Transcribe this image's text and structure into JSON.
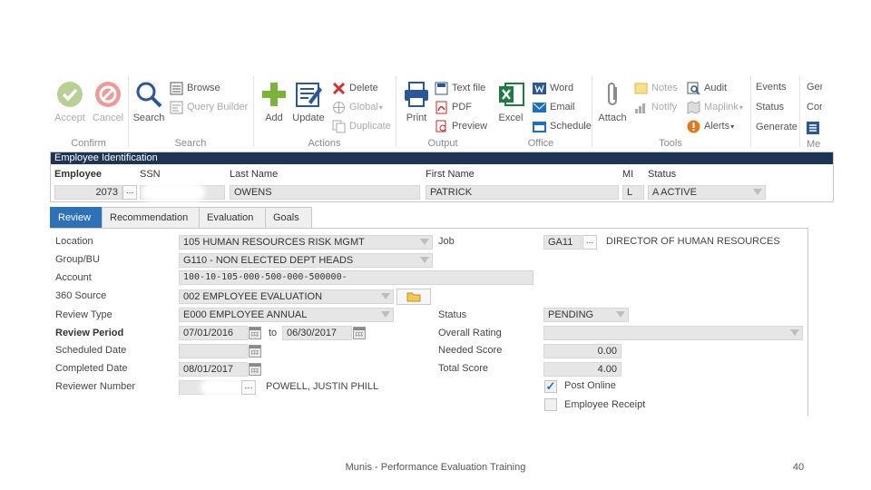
{
  "ribbon": {
    "confirm": {
      "group_label": "Confirm",
      "accept": "Accept",
      "cancel": "Cancel"
    },
    "search": {
      "group_label": "Search",
      "search": "Search",
      "browse": "Browse",
      "query_builder": "Query Builder"
    },
    "actions": {
      "group_label": "Actions",
      "add": "Add",
      "update": "Update",
      "delete": "Delete",
      "global": "Global",
      "duplicate": "Duplicate"
    },
    "output": {
      "group_label": "Output",
      "print": "Print",
      "text_file": "Text file",
      "pdf": "PDF",
      "preview": "Preview"
    },
    "office": {
      "group_label": "Office",
      "excel": "Excel",
      "word": "Word",
      "email": "Email",
      "schedule": "Schedule"
    },
    "tools": {
      "group_label": "Tools",
      "attach": "Attach",
      "notes": "Notes",
      "notify": "Notify",
      "audit": "Audit",
      "maplink": "Maplink",
      "alerts": "Alerts"
    },
    "extra": {
      "events": "Events",
      "status": "Status",
      "generate": "Generate",
      "gen_cut": "Ger",
      "con_cut": "Cor",
      "menu_cut": "Me"
    }
  },
  "employee_id": {
    "title": "Employee Identification",
    "headers": {
      "employee": "Employee",
      "ssn": "SSN",
      "last_name": "Last Name",
      "first_name": "First Name",
      "mi": "MI",
      "status": "Status"
    },
    "values": {
      "employee": "2073",
      "ellipsis": "...",
      "last_name": "OWENS",
      "first_name": "PATRICK",
      "mi": "L",
      "status": "A   ACTIVE"
    }
  },
  "tabs": [
    "Review",
    "Recommendation",
    "Evaluation",
    "Goals"
  ],
  "review": {
    "location": {
      "label": "Location",
      "value": "105   HUMAN RESOURCES RISK MGMT"
    },
    "group_bu": {
      "label": "Group/BU",
      "value": "G110 - NON ELECTED DEPT HEADS"
    },
    "account": {
      "label": "Account",
      "value": "100-10-105-000-500-000-500000-"
    },
    "source_360": {
      "label": "360 Source",
      "value": "002   EMPLOYEE EVALUATION"
    },
    "review_type": {
      "label": "Review Type",
      "value": "E000   EMPLOYEE ANNUAL"
    },
    "review_period": {
      "label": "Review Period",
      "from": "07/01/2016",
      "to_label": "to",
      "to": "06/30/2017"
    },
    "scheduled_date": {
      "label": "Scheduled Date",
      "value": ""
    },
    "completed_date": {
      "label": "Completed Date",
      "value": "08/01/2017"
    },
    "reviewer_number": {
      "label": "Reviewer Number",
      "name": "POWELL, JUSTIN PHILL"
    },
    "job": {
      "label": "Job",
      "code": "GA11",
      "ellipsis": "...",
      "title": "DIRECTOR OF HUMAN RESOURCES"
    },
    "status": {
      "label": "Status",
      "value": "PENDING"
    },
    "overall_rating": {
      "label": "Overall Rating",
      "value": ""
    },
    "needed_score": {
      "label": "Needed Score",
      "value": "0.00"
    },
    "total_score": {
      "label": "Total Score",
      "value": "4.00"
    },
    "post_online": {
      "label": "Post Online",
      "checked": true,
      "mark": "✓"
    },
    "employee_receipt": {
      "label": "Employee Receipt",
      "checked": false
    }
  },
  "footer": {
    "text": "Munis - Performance Evaluation Training",
    "page": "40"
  },
  "colors": {
    "panel_header": "#1d3456",
    "active_tab": "#2d72b8",
    "add_green": "#7ab23a",
    "cancel_red": "#e05a5a",
    "excel_green": "#1f7a43",
    "word_blue": "#2b5797"
  }
}
